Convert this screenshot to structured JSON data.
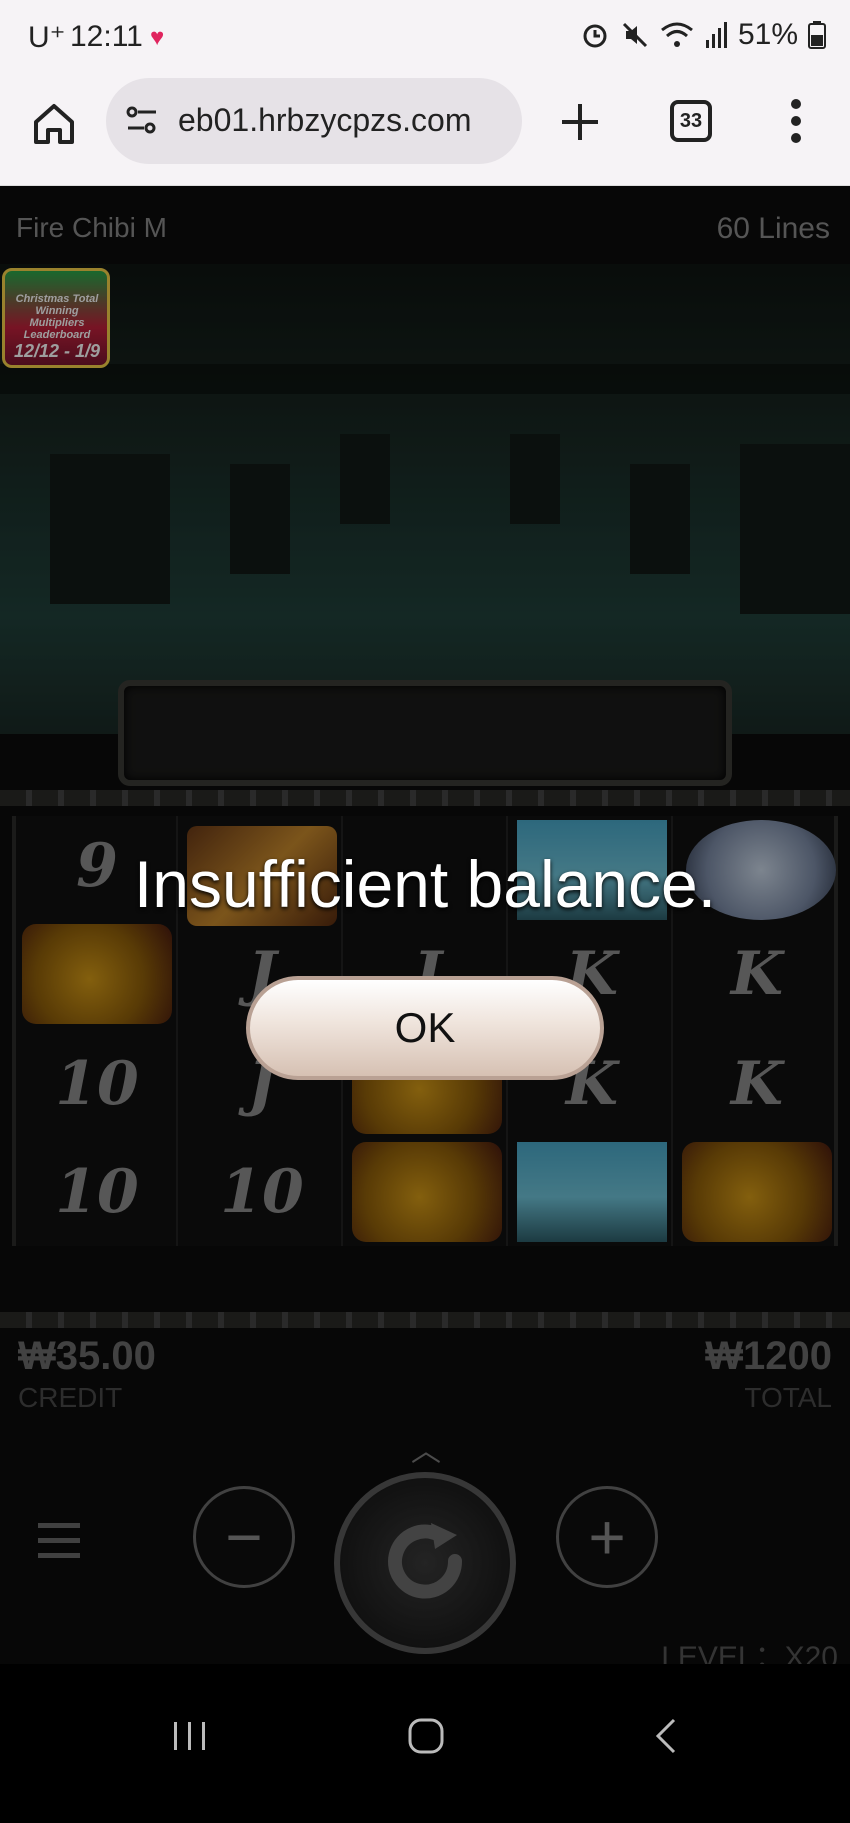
{
  "status_bar": {
    "carrier": "U⁺",
    "time": "12:11",
    "battery": "51%"
  },
  "browser": {
    "url": "eb01.hrbzycpzs.com",
    "tab_count": "33"
  },
  "game": {
    "title": "Fire Chibi M",
    "lines": "60 Lines",
    "promo_text": "Christmas Total Winning Multipliers Leaderboard",
    "promo_dates": "12/12 - 1/9",
    "message": "Insufficient balance.",
    "ok_label": "OK",
    "credit_value": "₩35.00",
    "credit_label": "CREDIT",
    "total_value": "₩1200",
    "total_label": "TOTAL",
    "level": "LEVEL：X20",
    "reels": [
      [
        "9",
        "lion",
        "10",
        "10"
      ],
      [
        "sword",
        "J",
        "J",
        "10"
      ],
      [
        "sword2",
        "J",
        "lion",
        "lion"
      ],
      [
        "ship",
        "K",
        "K",
        "ship"
      ],
      [
        "fan",
        "K",
        "K",
        "lion"
      ]
    ]
  }
}
